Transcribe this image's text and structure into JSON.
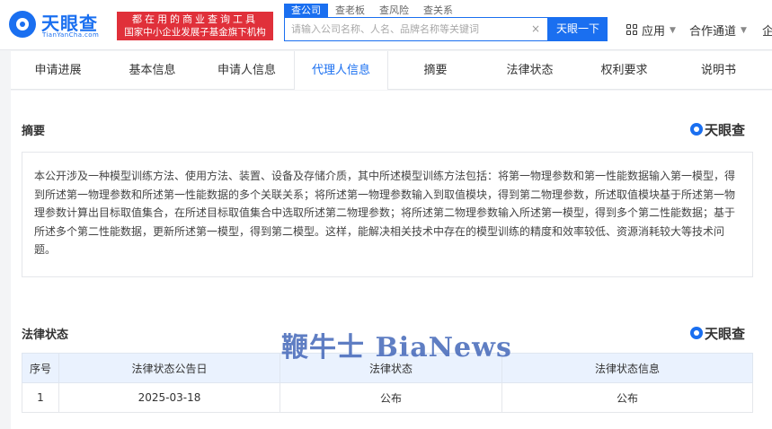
{
  "brand": {
    "name": "天眼查",
    "domain": "TianYanCha.com",
    "slogan_line1": "都在用的商业查询工具",
    "slogan_line2": "国家中小企业发展子基金旗下机构"
  },
  "search": {
    "tabs": [
      "查公司",
      "查老板",
      "查风险",
      "查关系"
    ],
    "active_tab": "查公司",
    "placeholder": "请输入公司名称、人名、品牌名称等关键词",
    "clear_symbol": "×",
    "button_label": "天眼一下"
  },
  "header_menu": {
    "apps_label": "应用",
    "cooperation_label": "合作通道",
    "enterprise_label": "企"
  },
  "nav_tabs": [
    {
      "label": "申请进展"
    },
    {
      "label": "基本信息"
    },
    {
      "label": "申请人信息"
    },
    {
      "label": "代理人信息"
    },
    {
      "label": "摘要"
    },
    {
      "label": "法律状态"
    },
    {
      "label": "权利要求"
    },
    {
      "label": "说明书"
    }
  ],
  "active_nav": "代理人信息",
  "abstract_section": {
    "title": "摘要",
    "badge": "天眼查",
    "text": "本公开涉及一种模型训练方法、使用方法、装置、设备及存储介质，其中所述模型训练方法包括：将第一物理参数和第一性能数据输入第一模型，得到所述第一物理参数和所述第一性能数据的多个关联关系；将所述第一物理参数输入到取值模块，得到第二物理参数，所述取值模块基于所述第一物理参数计算出目标取值集合，在所述目标取值集合中选取所述第二物理参数；将所述第二物理参数输入所述第一模型，得到多个第二性能数据；基于所述多个第二性能数据，更新所述第一模型，得到第二模型。这样，能解决相关技术中存在的模型训练的精度和效率较低、资源消耗较大等技术问题。"
  },
  "legal_section": {
    "title": "法律状态",
    "badge": "天眼查",
    "columns": [
      "序号",
      "法律状态公告日",
      "法律状态",
      "法律状态信息"
    ],
    "rows": [
      {
        "no": "1",
        "date": "2025-03-18",
        "status": "公布",
        "info": "公布"
      }
    ]
  },
  "watermark": "鞭牛士 BiaNews",
  "colors": {
    "brand_blue": "#1a6ff0",
    "slogan_red": "#e0303a",
    "table_header_bg": "#eaf2fe",
    "watermark": "#3d62b7"
  }
}
